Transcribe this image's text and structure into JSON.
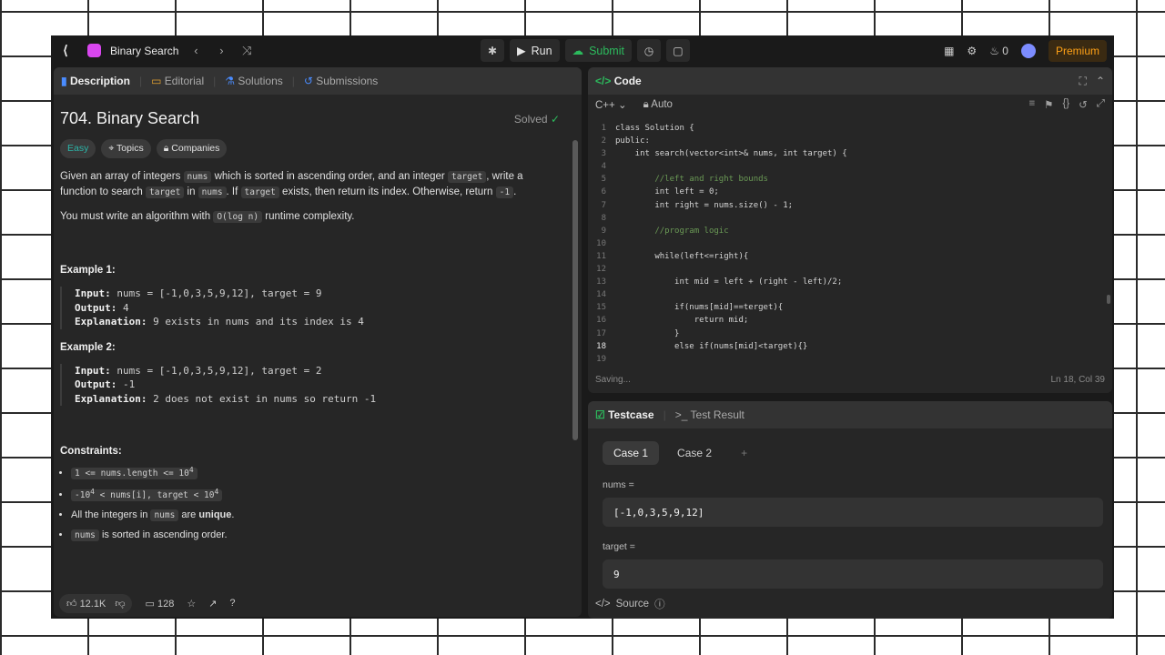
{
  "topbar": {
    "problem_title": "Binary Search",
    "run_label": "Run",
    "submit_label": "Submit",
    "streak_count": "0",
    "premium_label": "Premium"
  },
  "desc_tabs": [
    "Description",
    "Editorial",
    "Solutions",
    "Submissions"
  ],
  "problem": {
    "title": "704. Binary Search",
    "solved_label": "Solved",
    "difficulty": "Easy",
    "topics_label": "Topics",
    "companies_label": "Companies",
    "p1_a": "Given an array of integers ",
    "p1_code1": "nums",
    "p1_b": " which is sorted in ascending order, and an integer ",
    "p1_code2": "target",
    "p1_c": ", write a function to search ",
    "p1_code3": "target",
    "p1_d": " in ",
    "p1_code4": "nums",
    "p1_e": ". If ",
    "p1_code5": "target",
    "p1_f": " exists, then return its index. Otherwise, return ",
    "p1_code6": "-1",
    "p1_g": ".",
    "p2_a": "You must write an algorithm with ",
    "p2_code": "O(log n)",
    "p2_b": " runtime complexity.",
    "example1_title": "Example 1:",
    "example1": {
      "input_label": "Input:",
      "input": "nums = [-1,0,3,5,9,12], target = 9",
      "output_label": "Output:",
      "output": "4",
      "explanation_label": "Explanation:",
      "explanation": "9 exists in nums and its index is 4"
    },
    "example2_title": "Example 2:",
    "example2": {
      "input_label": "Input:",
      "input": "nums = [-1,0,3,5,9,12], target = 2",
      "output_label": "Output:",
      "output": "-1",
      "explanation_label": "Explanation:",
      "explanation": "2 does not exist in nums so return -1"
    },
    "constraints_title": "Constraints:",
    "c1_a": "1 <= nums.length <= 10",
    "c1_sup": "4",
    "c2_a": "-10",
    "c2_sup1": "4",
    "c2_b": " < nums[i], target < 10",
    "c2_sup2": "4",
    "c3_a": "All the integers in ",
    "c3_code": "nums",
    "c3_b": " are ",
    "c3_bold": "unique",
    "c3_c": ".",
    "c4_code": "nums",
    "c4_b": " is sorted in ascending order.",
    "likes": "12.1K",
    "comments": "128"
  },
  "code_panel": {
    "title": "Code",
    "language": "C++",
    "mode": "Auto",
    "status_left": "Saving...",
    "status_right": "Ln 18, Col 39"
  },
  "code_lines": [
    "class Solution {",
    "public:",
    "    int search(vector<int>& nums, int target) {",
    "",
    "        //left and right bounds",
    "        int left = 0;",
    "        int right = nums.size() - 1;",
    "",
    "        //program logic",
    "",
    "        while(left<=right){",
    "",
    "            int mid = left + (right - left)/2;",
    "",
    "            if(nums[mid]==terget){",
    "                return mid;",
    "            }",
    "            else if(nums[mid]<target){}",
    ""
  ],
  "testcase": {
    "tab_label": "Testcase",
    "result_label": "Test Result",
    "case1": "Case 1",
    "case2": "Case 2",
    "add": "+",
    "nums_label": "nums =",
    "nums_value": "[-1,0,3,5,9,12]",
    "target_label": "target =",
    "target_value": "9",
    "source_label": "Source"
  }
}
